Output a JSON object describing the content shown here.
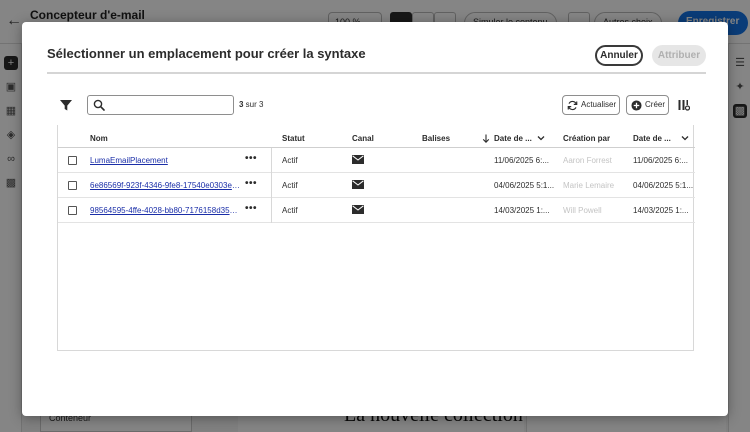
{
  "background": {
    "app_title": "Concepteur d'e-mail",
    "zoom": "100 %",
    "simulate_label": "Simuler le contenu",
    "more_label": "Autres choix",
    "save_label": "Enregistrer",
    "panel_item": "Conteneur",
    "canvas_text": "La nouvelle collection"
  },
  "modal": {
    "title": "Sélectionner un emplacement pour créer la syntaxe",
    "cancel_label": "Annuler",
    "assign_label": "Attribuer"
  },
  "toolbar": {
    "search_placeholder": "",
    "count_current": "3",
    "count_rest": " sur 3",
    "refresh_label": "Actualiser",
    "create_label": "Créer"
  },
  "table": {
    "columns": {
      "name": "Nom",
      "status": "Statut",
      "channel": "Canal",
      "tags": "Balises",
      "date_created": "Date de ...",
      "created_by": "Création par",
      "date_modified": "Date de ..."
    },
    "rows": [
      {
        "name": "LumaEmailPlacement",
        "status": "Actif",
        "channel_icon": "mail-icon",
        "date1": "11/06/2025 6:...",
        "author": "Aaron Forrest",
        "date2": "11/06/2025 6:..."
      },
      {
        "name": "6e86569f-923f-4346-9fe8-17540e0303e8...",
        "status": "Actif",
        "channel_icon": "mail-icon",
        "date1": "04/06/2025 5:1...",
        "author": "Marie Lemaire",
        "date2": "04/06/2025 5:1..."
      },
      {
        "name": "98564595-4ffe-4028-bb80-7176158d3546...",
        "status": "Actif",
        "channel_icon": "mail-icon",
        "date1": "14/03/2025 1:...",
        "author": "Will Powell",
        "date2": "14/03/2025 1:..."
      }
    ]
  },
  "colors": {
    "accent": "#1473e6",
    "link": "#1a2ea8",
    "overlay": "#000000"
  }
}
